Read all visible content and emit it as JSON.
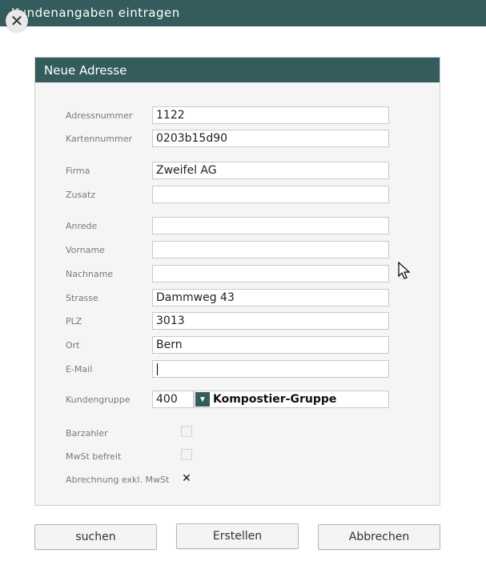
{
  "window": {
    "title": "Kundenangaben eintragen"
  },
  "panel": {
    "title": "Neue Adresse"
  },
  "fields": {
    "adressnummer": {
      "label": "Adressnummer",
      "value": "1122"
    },
    "kartennummer": {
      "label": "Kartennummer",
      "value": "0203b15d90"
    },
    "firma": {
      "label": "Firma",
      "value": "Zweifel AG"
    },
    "zusatz": {
      "label": "Zusatz",
      "value": ""
    },
    "anrede": {
      "label": "Anrede",
      "value": ""
    },
    "vorname": {
      "label": "Vorname",
      "value": ""
    },
    "nachname": {
      "label": "Nachname",
      "value": ""
    },
    "strasse": {
      "label": "Strasse",
      "value": "Dammweg 43"
    },
    "plz": {
      "label": "PLZ",
      "value": "3013"
    },
    "ort": {
      "label": "Ort",
      "value": "Bern"
    },
    "email": {
      "label": "E-Mail",
      "value": ""
    }
  },
  "kundengruppe": {
    "label": "Kundengruppe",
    "number": "400",
    "selected": "Kompostier-Gruppe"
  },
  "checkboxes": {
    "barzahler": {
      "label": "Barzahler",
      "checked": false
    },
    "mwst_befreit": {
      "label": "MwSt befreit",
      "checked": false
    },
    "abrechnung_exkl": {
      "label": "Abrechnung exkl. MwSt",
      "checked": true,
      "mark": "✕"
    }
  },
  "buttons": {
    "suchen": "suchen",
    "erstellen": "Erstellen",
    "abbrechen": "Abbrechen"
  },
  "icons": {
    "close": "close-icon",
    "dropdown": "chevron-down-icon",
    "cursor": "mouse-pointer-icon"
  },
  "colors": {
    "header": "#355c5c",
    "panel_bg": "#f5f5f5"
  }
}
